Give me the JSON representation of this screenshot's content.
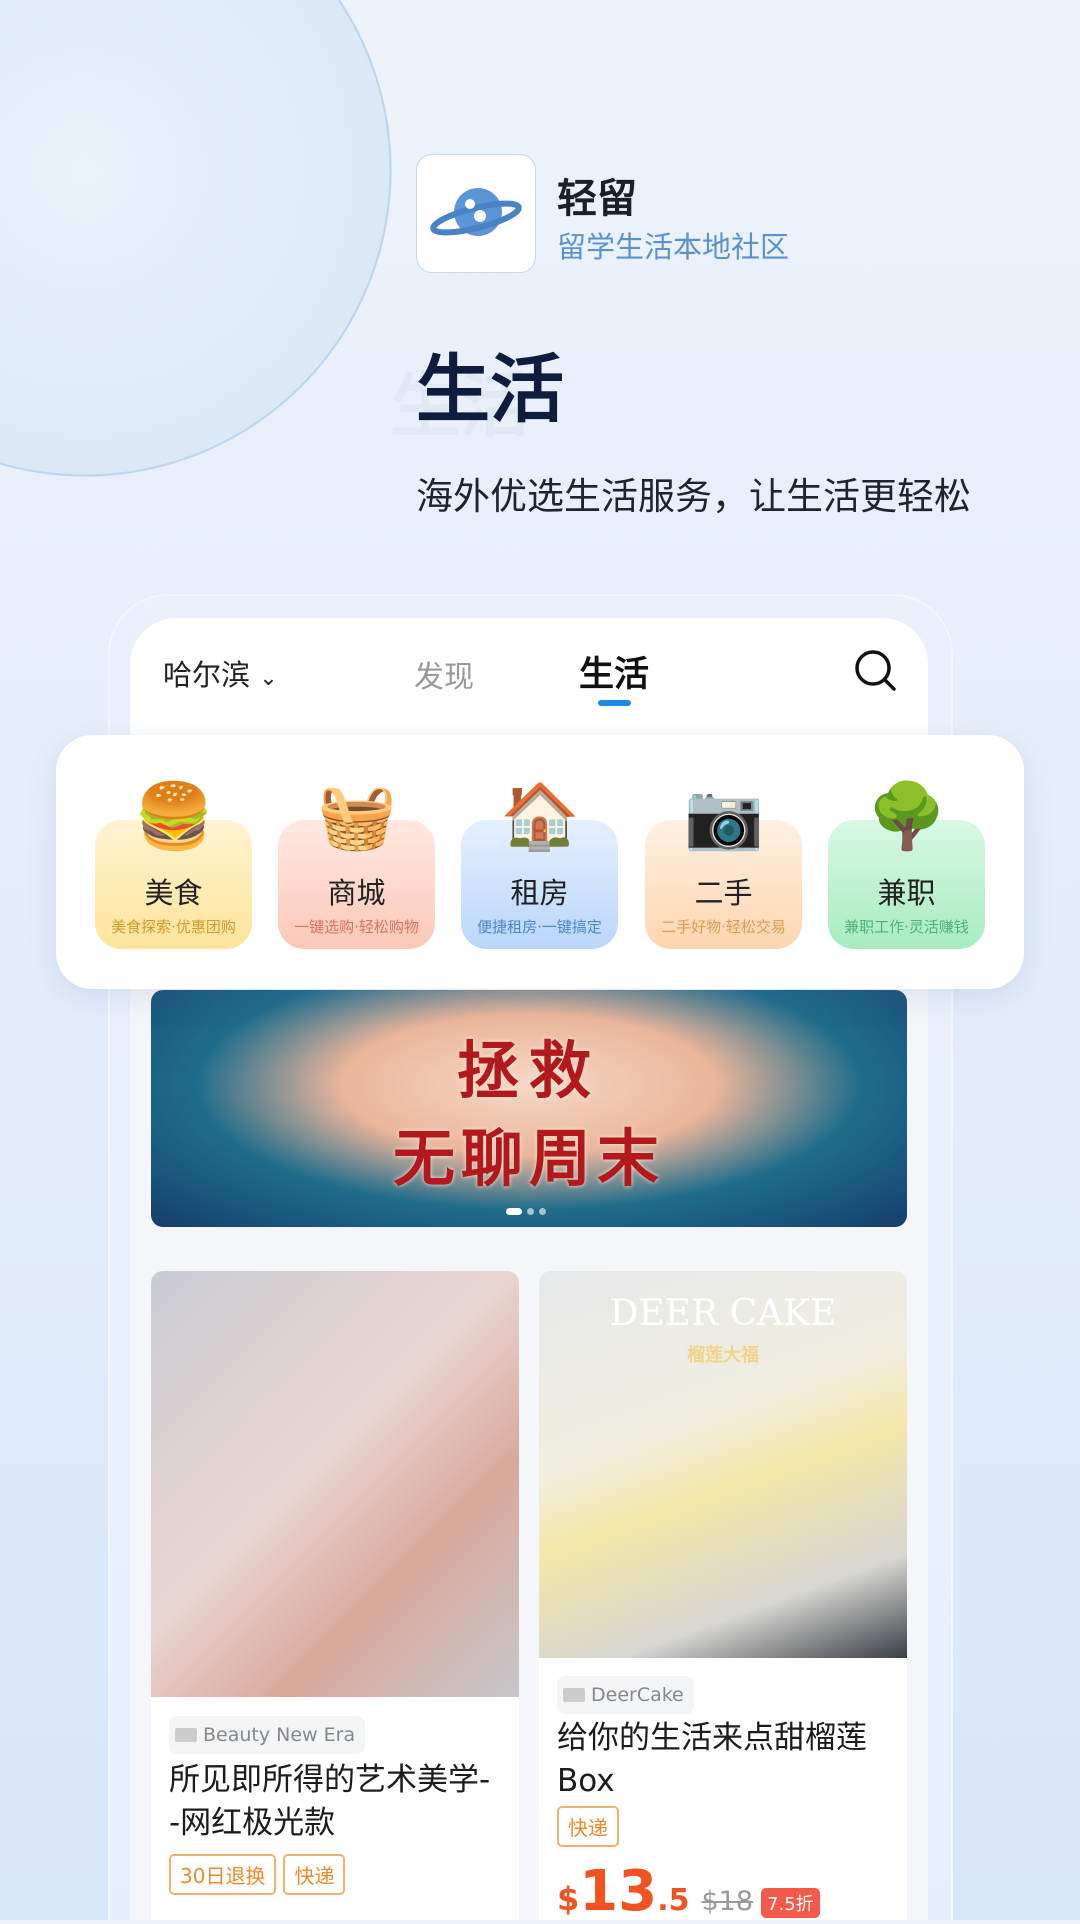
{
  "app": {
    "name": "轻留",
    "subtitle": "留学生活本地社区",
    "icon": "planet-chat-logo"
  },
  "hero": {
    "title": "生活",
    "tagline": "海外优选生活服务，让生活更轻松"
  },
  "header": {
    "city": "哈尔滨",
    "tabs": [
      {
        "label": "发现",
        "active": false
      },
      {
        "label": "生活",
        "active": true
      }
    ],
    "accent": "#1e88e5"
  },
  "categories": [
    {
      "label": "美食",
      "desc": "美食探索·优惠团购",
      "icon": "burger-icon",
      "color": "#fde7a6",
      "text": "#d7982c"
    },
    {
      "label": "商城",
      "desc": "一键选购·轻松购物",
      "icon": "basket-icon",
      "color": "#fdd1c5",
      "text": "#e0725c"
    },
    {
      "label": "租房",
      "desc": "便捷租房·一键搞定",
      "icon": "house-icon",
      "color": "#c9e0fc",
      "text": "#4b86cf"
    },
    {
      "label": "二手",
      "desc": "二手好物·轻松交易",
      "icon": "camera-icon",
      "color": "#fde0c4",
      "text": "#e5994f"
    },
    {
      "label": "兼职",
      "desc": "兼职工作·灵活赚钱",
      "icon": "money-tree-icon",
      "color": "#bff0cf",
      "text": "#4fb27a"
    }
  ],
  "banner": {
    "line1": "拯救",
    "line2": "无聊周末",
    "slides": 3,
    "active_slide": 0
  },
  "feed": [
    {
      "source": "Beauty New Era",
      "title": "所见即所得的艺术美学--网红极光款",
      "tags": [
        "30日退换",
        "快递"
      ]
    },
    {
      "source": "DeerCake",
      "image_text": "DEER CAKE",
      "image_sub": "榴莲大福",
      "title": "给你的生活来点甜榴莲Box",
      "tags": [
        "快递"
      ],
      "price_currency": "$",
      "price_int": "13",
      "price_dec": ".5",
      "original_price": "$18",
      "discount": "7.5折"
    }
  ]
}
